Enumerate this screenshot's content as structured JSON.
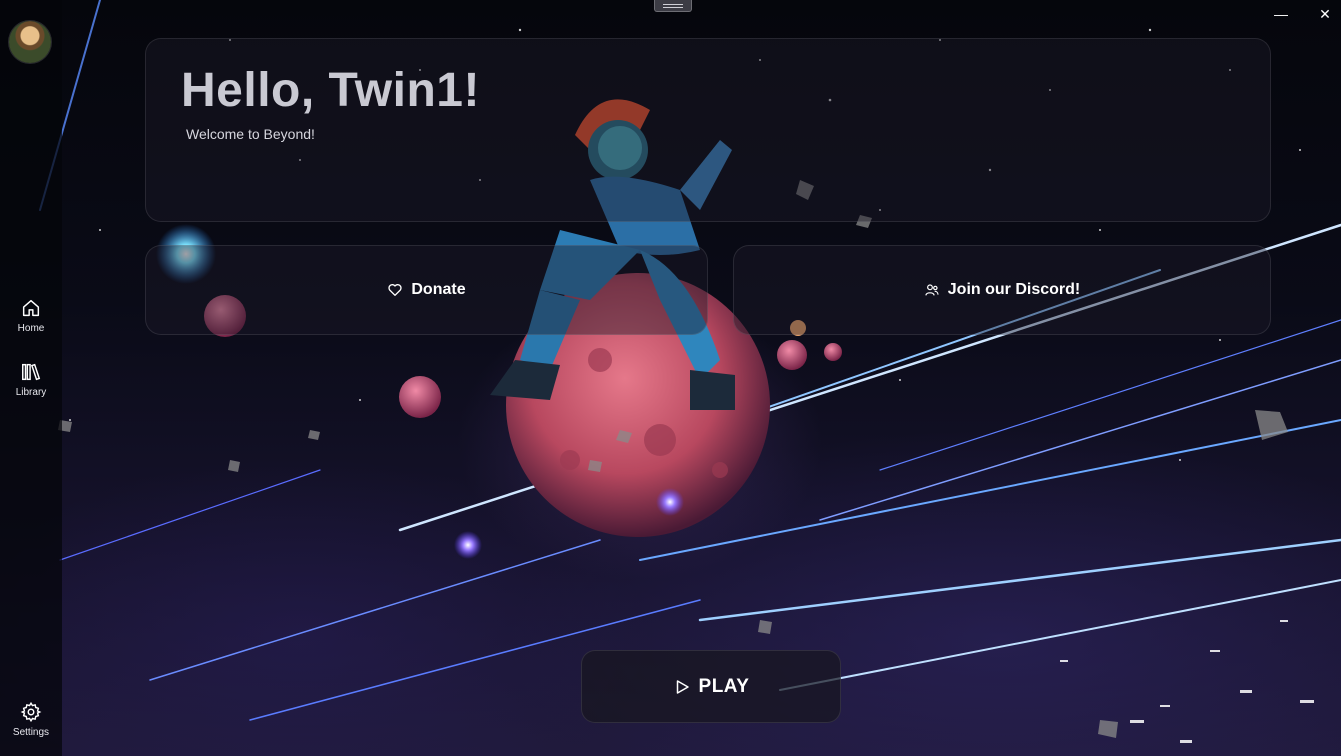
{
  "sidebar": {
    "items": [
      {
        "label": "Home",
        "icon": "home-icon"
      },
      {
        "label": "Library",
        "icon": "library-icon"
      },
      {
        "label": "Settings",
        "icon": "gear-icon"
      }
    ]
  },
  "hero": {
    "title": "Hello, Twin1!",
    "subtitle": "Welcome to Beyond!"
  },
  "actions": {
    "donate_label": "Donate",
    "discord_label": "Join our Discord!"
  },
  "play": {
    "label": "PLAY"
  },
  "window": {
    "minimize": "—",
    "close": "✕"
  },
  "colors": {
    "accent": "#ffffff",
    "panel": "#1c1a28"
  }
}
